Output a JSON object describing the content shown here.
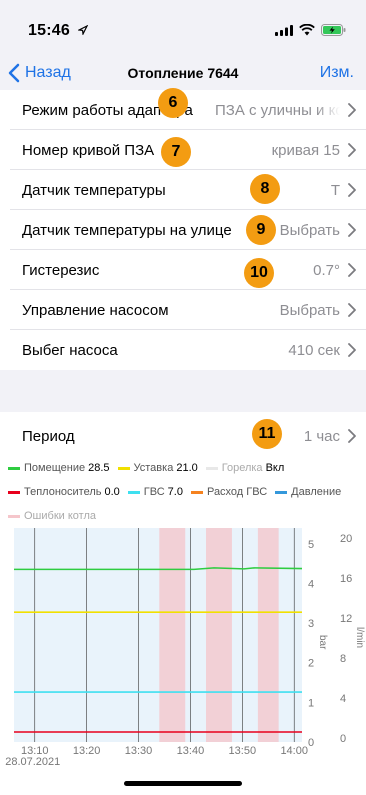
{
  "status_bar": {
    "time": "15:46"
  },
  "nav": {
    "back_label": "Назад",
    "title": "Отопление 7644",
    "edit_label": "Изм."
  },
  "settings": [
    {
      "label": "Режим работы адаптера",
      "value": "ПЗА с уличны и комнатным"
    },
    {
      "label": "Номер кривой ПЗА",
      "value": "кривая 15"
    },
    {
      "label": "Датчик температуры",
      "value": "Т"
    },
    {
      "label": "Датчик температуры на улице",
      "value": "Выбрать"
    },
    {
      "label": "Гистерезис",
      "value": "0.7°"
    },
    {
      "label": "Управление насосом",
      "value": "Выбрать"
    },
    {
      "label": "Выбег насоса",
      "value": "410 сек"
    }
  ],
  "badges": [
    "6",
    "7",
    "8",
    "9",
    "10",
    "11"
  ],
  "period": {
    "label": "Период",
    "value": "1 час"
  },
  "legend": [
    {
      "name": "Помещение",
      "value": "28.5",
      "color": "#2ecc40"
    },
    {
      "name": "Уставка",
      "value": "21.0",
      "color": "#f1e000"
    },
    {
      "name": "Горелка",
      "value": "Вкл",
      "color": "#e8e8e8"
    },
    {
      "name": "Теплоноситель",
      "value": "0.0",
      "color": "#e8001c"
    },
    {
      "name": "ГВС",
      "value": "7.0",
      "color": "#3ee0f0"
    },
    {
      "name": "Расход ГВС",
      "value": "",
      "color": "#f5821f"
    },
    {
      "name": "Давление",
      "value": "",
      "color": "#3498db"
    },
    {
      "name": "Ошибки котла",
      "value": "",
      "color": "#f5c6cb"
    }
  ],
  "colors": {
    "accent": "#1f73e6",
    "badge": "#f39c12",
    "plot_bg": "#e9f3fb"
  },
  "chart_data": {
    "type": "line",
    "x_ticks": [
      "13:10",
      "13:20",
      "13:30",
      "13:40",
      "13:50",
      "14:00"
    ],
    "x_subtitle": "28.07.2021",
    "y_left_ticks": [
      "0",
      "1",
      "2",
      "3",
      "4",
      "5"
    ],
    "y_left_label": "bar",
    "y_right_ticks": [
      "0",
      "4",
      "8",
      "12",
      "16",
      "20"
    ],
    "y_right_label": "l/min",
    "error_bands": [
      [
        "13:34",
        "13:39"
      ],
      [
        "13:43",
        "13:48"
      ],
      [
        "13:53",
        "13:57"
      ]
    ],
    "series": [
      {
        "name": "Помещение",
        "color": "#2ecc40",
        "value": 28.5
      },
      {
        "name": "Уставка",
        "color": "#f1e000",
        "value": 21.0
      },
      {
        "name": "ГВС",
        "color": "#3ee0f0",
        "value": 7.0
      },
      {
        "name": "Теплоноситель",
        "color": "#e8001c",
        "value": 0.0
      }
    ]
  }
}
